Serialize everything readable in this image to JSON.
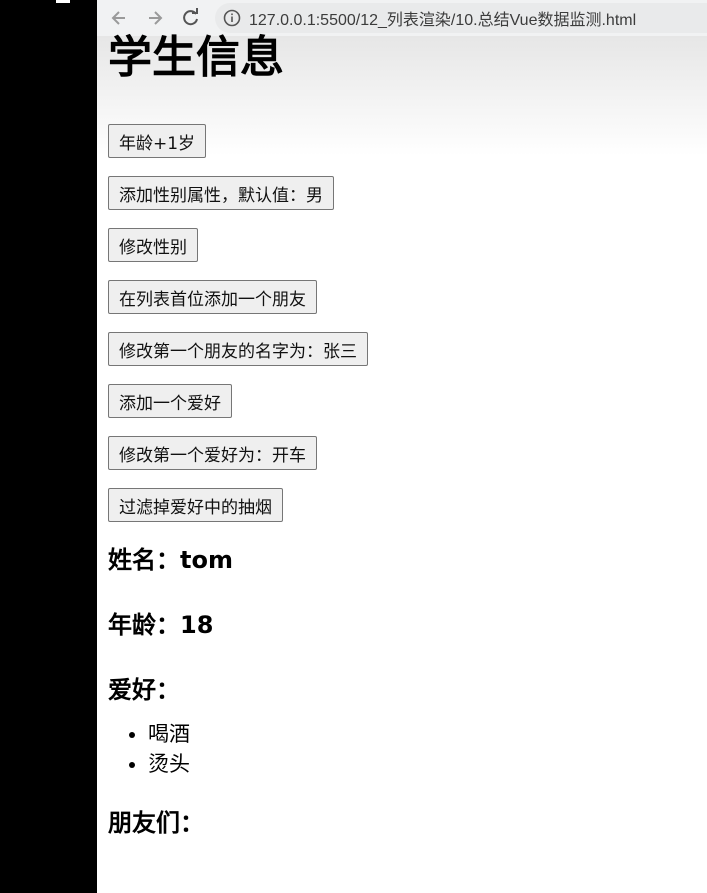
{
  "browser": {
    "url": "127.0.0.1:5500/12_列表渲染/10.总结Vue数据监测.html"
  },
  "page": {
    "title": "学生信息",
    "buttons": [
      "年龄+1岁",
      "添加性别属性，默认值：男",
      "修改性别",
      "在列表首位添加一个朋友",
      "修改第一个朋友的名字为：张三",
      "添加一个爱好",
      "修改第一个爱好为：开车",
      "过滤掉爱好中的抽烟"
    ],
    "name_line": "姓名：tom",
    "age_line": "年龄：18",
    "hobby_heading": "爱好：",
    "hobbies": [
      "喝酒",
      "烫头"
    ],
    "friends_heading": "朋友们："
  }
}
